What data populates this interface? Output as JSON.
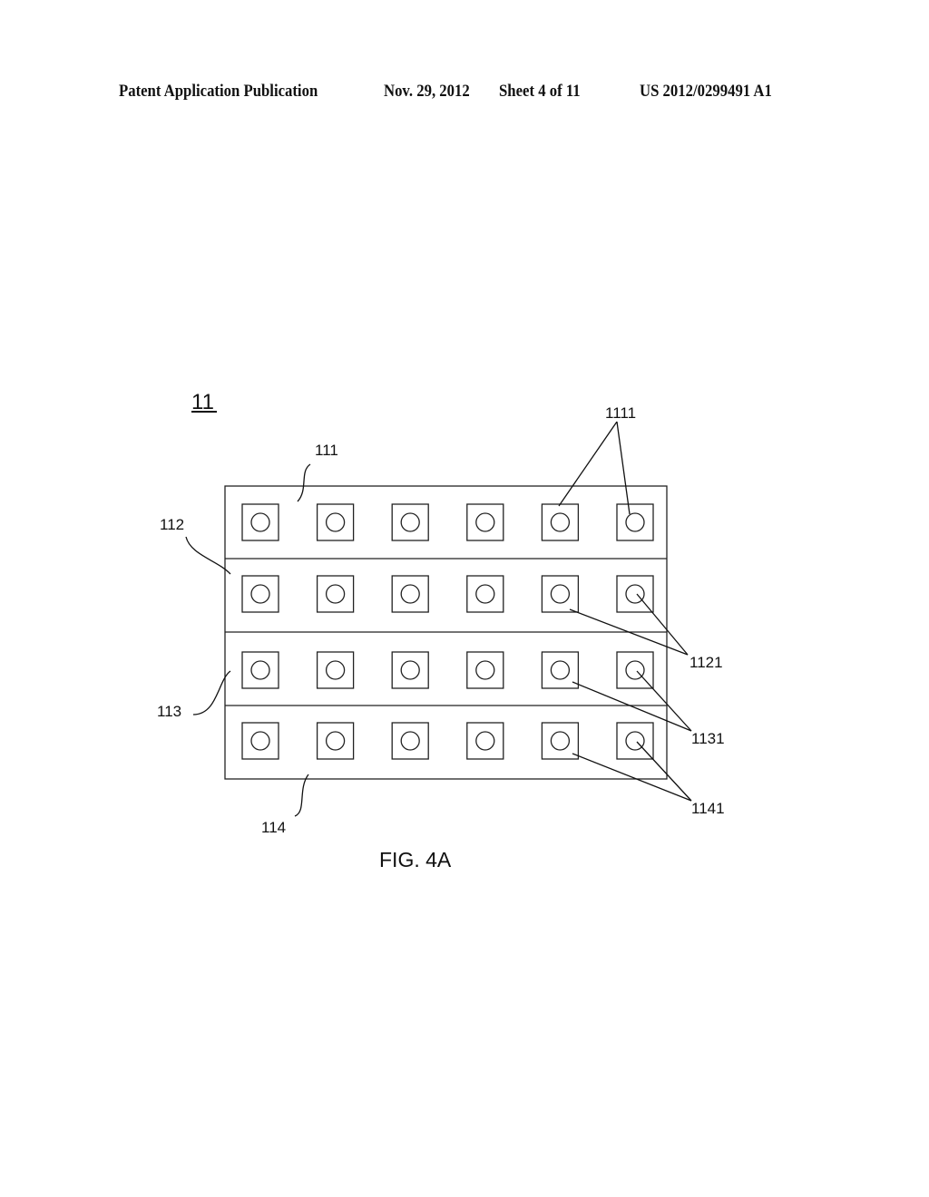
{
  "header": {
    "publication_type": "Patent Application Publication",
    "date": "Nov. 29, 2012",
    "sheet": "Sheet 4 of 11",
    "patent_number": "US 2012/0299491 A1"
  },
  "figure": {
    "caption": "FIG. 4A",
    "component_ref": "11",
    "rows": [
      {
        "ref": "111",
        "element_ref": "1111",
        "cells": 6
      },
      {
        "ref": "112",
        "element_ref": "1121",
        "cells": 6
      },
      {
        "ref": "113",
        "element_ref": "1131",
        "cells": 6
      },
      {
        "ref": "114",
        "element_ref": "1141",
        "cells": 6
      }
    ]
  }
}
